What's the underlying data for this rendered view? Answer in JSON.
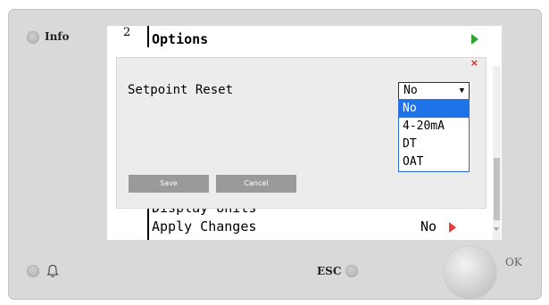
{
  "hardware": {
    "info_label": "Info",
    "esc_label": "ESC",
    "ok_label": "OK"
  },
  "menu": {
    "number": "2",
    "title": "Options",
    "partial_row_label": "Display Units",
    "apply_label": "Apply Changes",
    "apply_value": "No"
  },
  "dialog": {
    "close_label": "×",
    "setting_label": "Setpoint Reset",
    "selected_value": "No",
    "options": [
      "No",
      "4-20mA",
      "DT",
      "OAT"
    ],
    "save_label": "Save",
    "cancel_label": "Cancel"
  },
  "colors": {
    "nav_arrow": "#2fa22f",
    "edit_arrow": "#e83a3a",
    "selected_option": "#1e73e8"
  }
}
